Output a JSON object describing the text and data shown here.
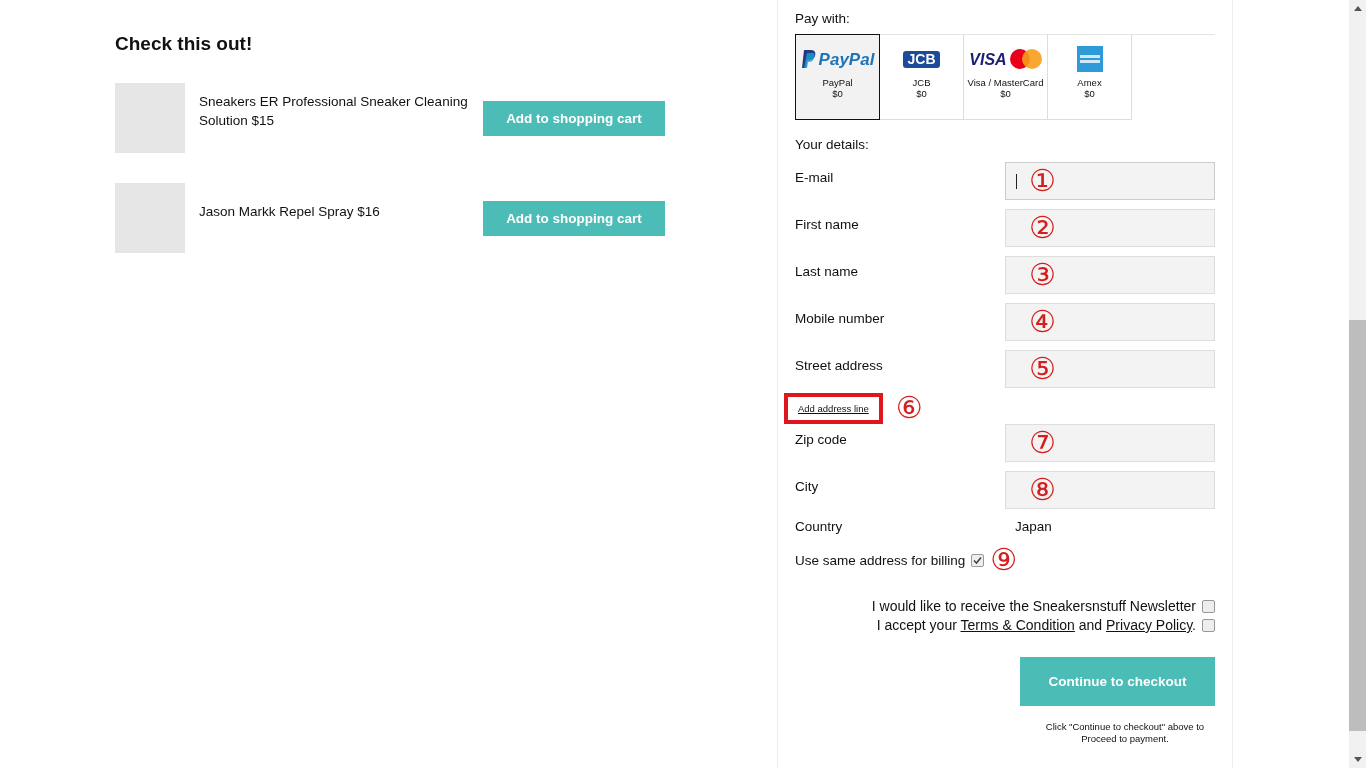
{
  "recommendations": {
    "title": "Check this out!",
    "products": [
      {
        "name": "Sneakers ER Professional Sneaker Cleaning Solution $15",
        "button": "Add to shopping cart"
      },
      {
        "name": "Jason Markk Repel Spray $16",
        "button": "Add to shopping cart"
      }
    ]
  },
  "checkout": {
    "pay_title": "Pay with:",
    "payment_methods": [
      {
        "kind": "paypal",
        "logo": "PayPal",
        "name": "PayPal",
        "price": "$0",
        "selected": true
      },
      {
        "kind": "jcb",
        "logo": "JCB",
        "name": "JCB",
        "price": "$0",
        "selected": false
      },
      {
        "kind": "visa_mastercard",
        "logo": "VISA",
        "name": "Visa / MasterCard",
        "price": "$0",
        "selected": false
      },
      {
        "kind": "amex",
        "name": "Amex",
        "price": "$0",
        "selected": false
      }
    ],
    "details_title": "Your details:",
    "rows": [
      {
        "kind": "input",
        "label": "E-mail",
        "marker": "①",
        "focused": true
      },
      {
        "kind": "input",
        "label": "First name",
        "marker": "②",
        "focused": false
      },
      {
        "kind": "input",
        "label": "Last name",
        "marker": "③",
        "focused": false
      },
      {
        "kind": "input",
        "label": "Mobile number",
        "marker": "④",
        "focused": false
      },
      {
        "kind": "input",
        "label": "Street address",
        "marker": "⑤",
        "focused": false
      },
      {
        "kind": "link",
        "label": "Add address line",
        "marker": "⑥",
        "highlighted": true
      },
      {
        "kind": "input",
        "label": "Zip code",
        "marker": "⑦",
        "focused": false
      },
      {
        "kind": "input",
        "label": "City",
        "marker": "⑧",
        "focused": false
      },
      {
        "kind": "static",
        "label": "Country",
        "value": "Japan"
      },
      {
        "kind": "checkbox",
        "label": "Use same address for billing",
        "marker": "⑨",
        "checked": true
      }
    ],
    "consents": [
      {
        "parts": [
          {
            "text": "I would like to receive the Sneakersnstuff Newsletter"
          }
        ],
        "checked": false
      },
      {
        "parts": [
          {
            "text": "I accept your "
          },
          {
            "link": "Terms & Condition"
          },
          {
            "text": " and "
          },
          {
            "link": "Privacy Policy"
          },
          {
            "text": "."
          }
        ],
        "checked": false
      }
    ],
    "button": "Continue to checkout",
    "note": "Click \"Continue to checkout\" above to Proceed to payment."
  }
}
